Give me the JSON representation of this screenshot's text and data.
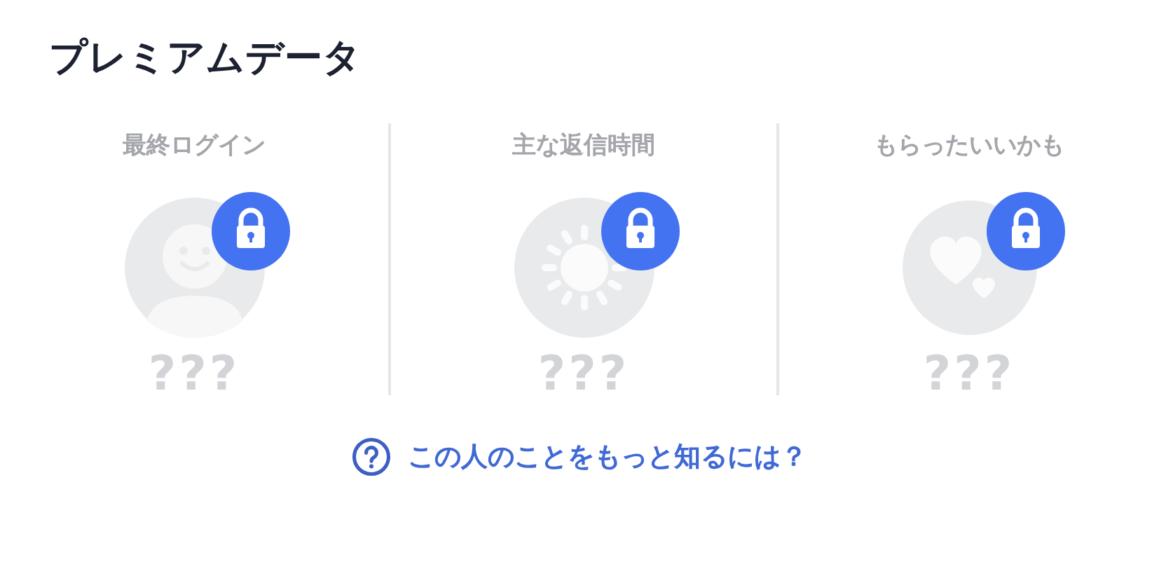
{
  "title": "プレミアムデータ",
  "items": [
    {
      "label": "最終ログイン",
      "kind": "person",
      "locked": true,
      "value": "???"
    },
    {
      "label": "主な返信時間",
      "kind": "sun",
      "locked": true,
      "value": "???"
    },
    {
      "label": "もらったいいかも",
      "kind": "hearts",
      "locked": true,
      "value": "???"
    }
  ],
  "help_link": "この人のことをもっと知るには？"
}
